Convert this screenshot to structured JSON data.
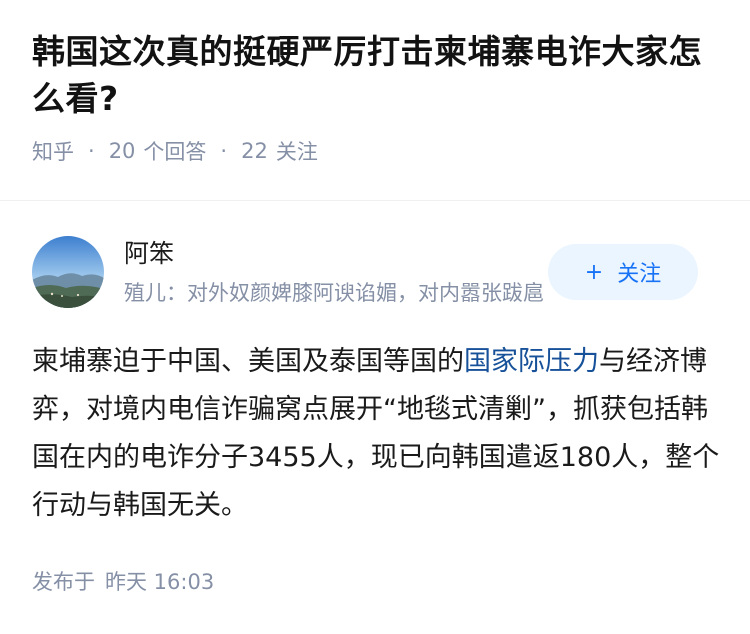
{
  "question": {
    "title": "韩国这次真的挺硬严厉打击柬埔寨电诈大家怎么看?",
    "source": "知乎",
    "answer_count": "20",
    "answer_label": "个回答",
    "follower_count": "22",
    "follower_label": "关注"
  },
  "author": {
    "name": "阿笨",
    "bio": "殖儿：对外奴颜婢膝阿谀谄媚，对内嚣张跋扈",
    "follow_label": "关注",
    "follow_icon": "plus-icon"
  },
  "answer": {
    "text_before": "柬埔寨迫于中国、美国及泰国等国的",
    "link_text": "国家际压力",
    "text_after": "与经济博弈，对境内电信诈骗窝点展开“地毯式清剿”，抓获包括韩国在内的电诈分子3455人，现已向韩国遣返180人，整个行动与韩国无关。"
  },
  "publish": {
    "label": "发布于",
    "time": "昨天 16:03"
  },
  "colors": {
    "accent": "#1772f6",
    "follow_bg": "#ebf5ff",
    "meta": "#8590a6",
    "link": "#175199"
  }
}
